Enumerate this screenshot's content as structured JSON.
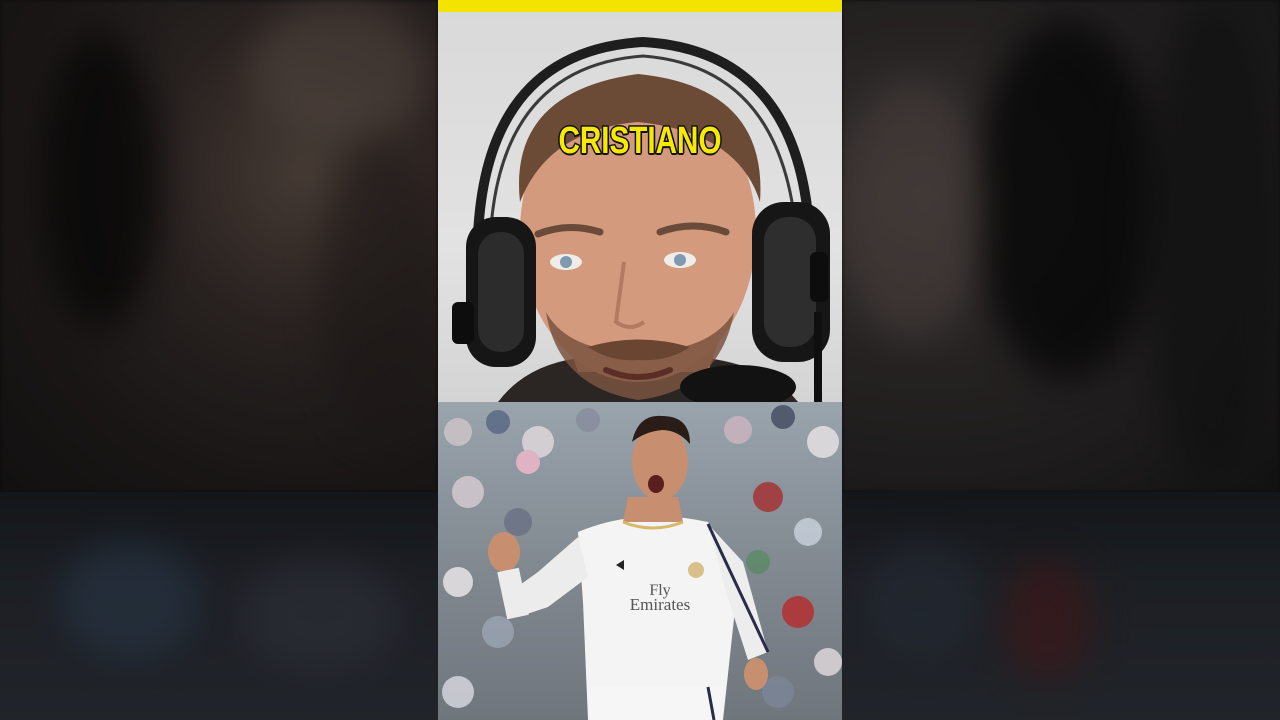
{
  "caption": "CRISTIANO",
  "jersey": {
    "sponsor_line1": "Fly",
    "sponsor_line2": "Emirates"
  },
  "colors": {
    "accent_bar": "#f3e400",
    "caption_fill": "#f7ea00",
    "caption_stroke": "#111111"
  },
  "icons": [
    "headphones-icon",
    "microphone-icon"
  ]
}
